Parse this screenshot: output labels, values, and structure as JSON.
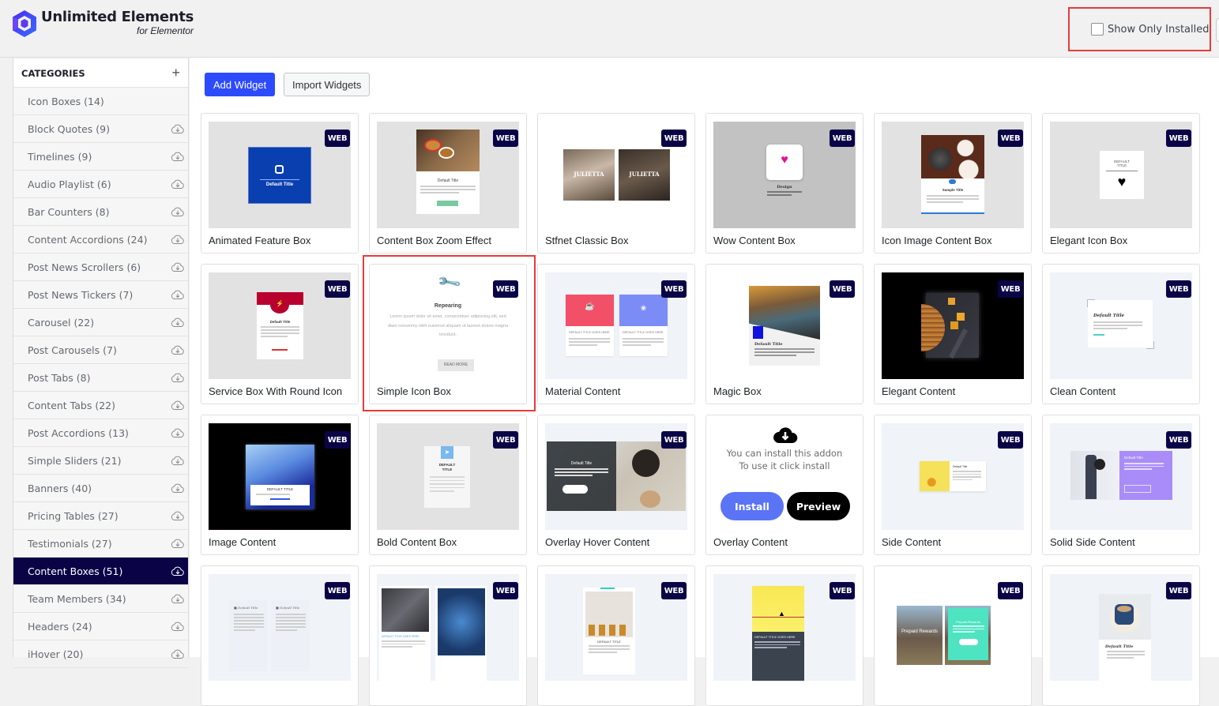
{
  "brand": {
    "title": "Unlimited Elements",
    "subtitle": "for Elementor",
    "accent": "#2c4bff",
    "dark": "#0a0447"
  },
  "filter": {
    "show_only_installed_label": "Show Only Installed",
    "show_only_installed_checked": false
  },
  "sidebar": {
    "header": "CATEGORIES",
    "add_label": "+",
    "items": [
      {
        "label": "Icon Boxes (14)",
        "download": false,
        "active": false
      },
      {
        "label": "Block Quotes (9)",
        "download": true,
        "active": false
      },
      {
        "label": "Timelines (9)",
        "download": true,
        "active": false
      },
      {
        "label": "Audio Playlist (6)",
        "download": true,
        "active": false
      },
      {
        "label": "Bar Counters (8)",
        "download": true,
        "active": false
      },
      {
        "label": "Content Accordions (24)",
        "download": true,
        "active": false
      },
      {
        "label": "Post News Scrollers (6)",
        "download": true,
        "active": false
      },
      {
        "label": "Post News Tickers (7)",
        "download": true,
        "active": false
      },
      {
        "label": "Carousel (22)",
        "download": true,
        "active": false
      },
      {
        "label": "Post Carousels (7)",
        "download": true,
        "active": false
      },
      {
        "label": "Post Tabs (8)",
        "download": true,
        "active": false
      },
      {
        "label": "Content Tabs (22)",
        "download": true,
        "active": false
      },
      {
        "label": "Post Accordions (13)",
        "download": true,
        "active": false
      },
      {
        "label": "Simple Sliders (21)",
        "download": true,
        "active": false
      },
      {
        "label": "Banners (40)",
        "download": true,
        "active": false
      },
      {
        "label": "Pricing Tables (27)",
        "download": true,
        "active": false
      },
      {
        "label": "Testimonials (27)",
        "download": true,
        "active": false
      },
      {
        "label": "Content Boxes (51)",
        "download": true,
        "active": true
      },
      {
        "label": "Team Members (34)",
        "download": true,
        "active": false
      },
      {
        "label": "Headers (24)",
        "download": true,
        "active": false
      },
      {
        "label": "iHover (20)",
        "download": true,
        "active": false
      }
    ]
  },
  "toolbar": {
    "add_widget": "Add Widget",
    "import_widgets": "Import Widgets"
  },
  "badge_label": "WEB",
  "install_prompt": {
    "line1": "You can install this addon",
    "line2": "To use it click install",
    "install": "Install",
    "preview": "Preview"
  },
  "widgets": [
    {
      "title": "Animated Feature Box",
      "thumb": "feature",
      "caption": "Default Title"
    },
    {
      "title": "Content Box Zoom Effect",
      "thumb": "zoom",
      "caption": "Default Title"
    },
    {
      "title": "Stfnet Classic Box",
      "thumb": "stfnet",
      "caption": "JULIETTA"
    },
    {
      "title": "Wow Content Box",
      "thumb": "wow",
      "caption": "Design"
    },
    {
      "title": "Icon Image Content Box",
      "thumb": "iconimage",
      "caption": "Sample Title"
    },
    {
      "title": "Elegant Icon Box",
      "thumb": "elegant",
      "caption": "DEFAULT TITLE"
    },
    {
      "title": "Service Box With Round Icon",
      "thumb": "service",
      "caption": "Default Title"
    },
    {
      "title": "Simple Icon Box",
      "thumb": "simple",
      "caption": "Repearing",
      "body": "Lorem ipsum dolor sit amet, consectetuer adipiscing elit, sed diam nonummy nibh euismod aliquam ut laoreet dolore magna tincidunt.",
      "button": "READ MORE"
    },
    {
      "title": "Material Content",
      "thumb": "material",
      "caption": "DEFAULT TITLE GOES HERE"
    },
    {
      "title": "Magic Box",
      "thumb": "magic",
      "caption": "Default Title"
    },
    {
      "title": "Elegant Content",
      "thumb": "elegantcontent",
      "caption": ""
    },
    {
      "title": "Clean Content",
      "thumb": "clean",
      "caption": "Default Title"
    },
    {
      "title": "Image Content",
      "thumb": "image",
      "caption": "DEFAULT TITLE"
    },
    {
      "title": "Bold Content Box",
      "thumb": "bold",
      "caption": "DEFAULT TITLE"
    },
    {
      "title": "Overlay Hover Content",
      "thumb": "overlayhover",
      "caption": "Default Title"
    },
    {
      "title": "Overlay Content",
      "thumb": "install",
      "caption": ""
    },
    {
      "title": "Side Content",
      "thumb": "side",
      "caption": "Default Title"
    },
    {
      "title": "Solid Side Content",
      "thumb": "solidside",
      "caption": "Default Title"
    },
    {
      "title": "",
      "thumb": "twocol",
      "caption": "Default Title"
    },
    {
      "title": "",
      "thumb": "bird",
      "caption": "DEFAULT TITLE GOES HERE"
    },
    {
      "title": "",
      "thumb": "pineapple",
      "caption": "DEFAULT TITLE"
    },
    {
      "title": "",
      "thumb": "yellowbird",
      "caption": "DEFAULT TITLE GOES HERE"
    },
    {
      "title": "",
      "thumb": "prepaid",
      "caption": "Prepaid Rewards"
    },
    {
      "title": "",
      "thumb": "coffee",
      "caption": "Default Title"
    }
  ]
}
